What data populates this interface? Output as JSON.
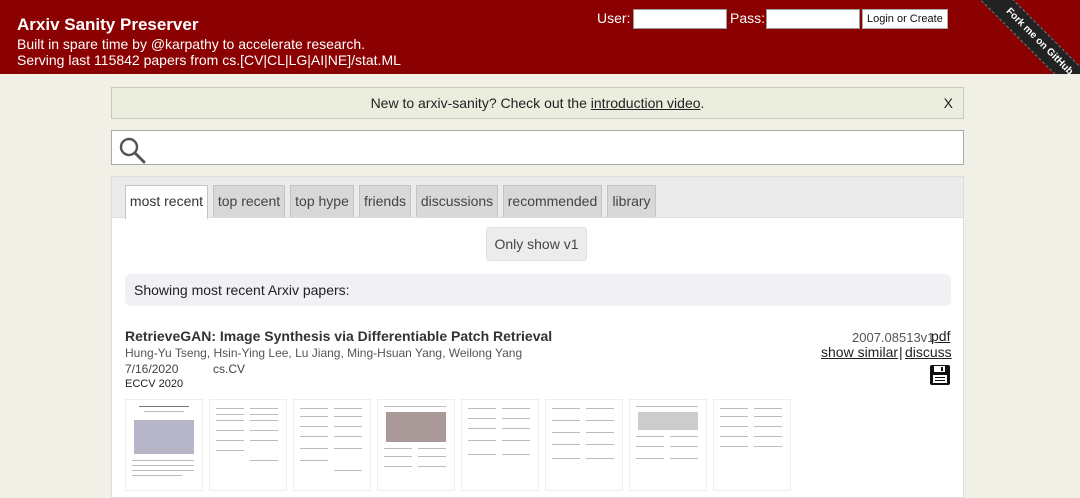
{
  "header": {
    "title": "Arxiv Sanity Preserver",
    "subtitle": "Built in spare time by @karpathy to accelerate research.",
    "serving": "Serving last 115842 papers from cs.[CV|CL|LG|AI|NE]/stat.ML"
  },
  "login": {
    "user_label": "User:",
    "pass_label": "Pass:",
    "user_value": "",
    "pass_value": "",
    "button_label": "Login or Create"
  },
  "ribbon": {
    "text": "Fork me on GitHub"
  },
  "notice": {
    "text_before": "New to arxiv-sanity? Check out the ",
    "link_text": "introduction video",
    "text_after": ".",
    "close_label": "X"
  },
  "search": {
    "placeholder": "",
    "value": ""
  },
  "tabs": [
    {
      "label": "most recent",
      "active": true
    },
    {
      "label": "top recent"
    },
    {
      "label": "top hype"
    },
    {
      "label": "friends"
    },
    {
      "label": "discussions"
    },
    {
      "label": "recommended"
    },
    {
      "label": "library"
    }
  ],
  "filter": {
    "only_v1_label": "Only show v1"
  },
  "status": {
    "showing_text": "Showing most recent Arxiv papers:"
  },
  "paper": {
    "title": "RetrieveGAN: Image Synthesis via Differentiable Patch Retrieval",
    "authors": "Hung-Yu Tseng, Hsin-Ying Lee, Lu Jiang, Ming-Hsuan Yang, Weilong Yang",
    "date": "7/16/2020",
    "category": "cs.CV",
    "venue": "ECCV 2020",
    "arxiv_id": "2007.08513v1",
    "pdf_label": "pdf",
    "similar_label": "show similar",
    "separator": "|",
    "discuss_label": "discuss",
    "save_icon": "floppy-disk-icon"
  }
}
